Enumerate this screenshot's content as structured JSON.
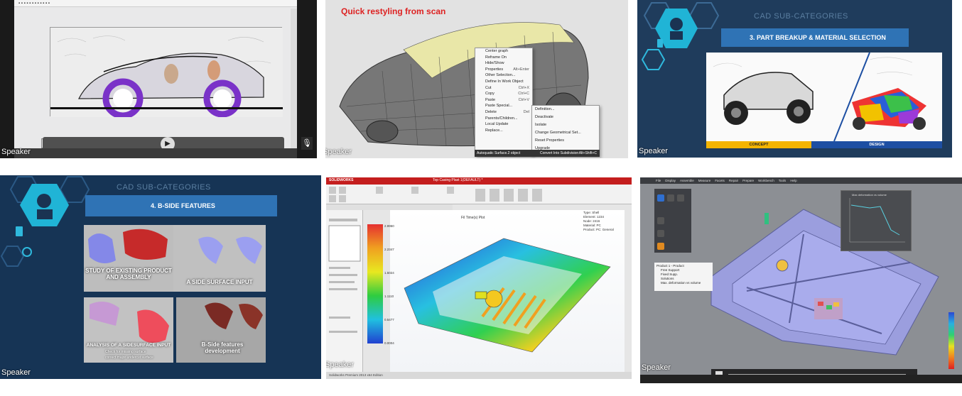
{
  "tiles": [
    {
      "speaker": "Speaker"
    },
    {
      "speaker": "Speaker",
      "heading": "Quick restyling from scan"
    },
    {
      "speaker": "Speaker",
      "category_title": "CAD SUB-CATEGORIES",
      "banner": "3. PART BREAKUP & MATERIAL SELECTION",
      "bar_left": "CONCEPT",
      "bar_right": "DESIGN"
    },
    {
      "speaker": "Speaker",
      "category_title": "CAD SUB-CATEGORIES",
      "banner": "4. B-SIDE FEATURES",
      "cards": {
        "study": "STUDY OF EXISTING PRODUCT AND ASSEMBLY",
        "aside": "A SIDE SURFACE INPUT",
        "analysis": "ANALYSIS OF A SIDESURFACE INPUT",
        "analysis_b1": "Check for missing surface",
        "analysis_b2": "correct major undercut surface",
        "bside": "B-Side features development"
      }
    },
    {
      "speaker": "Speaker",
      "app_logo": "SOLIDWORKS",
      "window_title": "Top Casing Plast 1(DEFAULT) *",
      "viewport_title": "Fil Time(s) Plot",
      "legend": [
        "2.9950",
        "2.2347",
        "1.5024",
        "1.1110",
        "0.5477",
        "0.0004"
      ],
      "info": [
        "Type: Shell",
        "Element: 1234",
        "Node: 2416",
        "Material: PC",
        "Product: PC: General"
      ],
      "status": "Solidworks Premium 2013 x64 Edition"
    },
    {
      "speaker": "Speaker",
      "menu": [
        "File",
        "Display",
        "Assemble",
        "Measure",
        "Facets",
        "Repair",
        "Prepare",
        "Workbench",
        "Tools",
        "Help"
      ],
      "graph_title": "Max deformation vs volume",
      "tree": [
        "Product 1 - Product",
        "Free Support",
        "Fixed Supp.",
        "Solutions",
        "Max. deformation vs volume"
      ]
    }
  ],
  "context_menu": [
    {
      "label": "Center graph",
      "shortcut": ""
    },
    {
      "label": "Reframe On",
      "shortcut": ""
    },
    {
      "label": "Hide/Show",
      "shortcut": ""
    },
    {
      "label": "Properties",
      "shortcut": "Alt+Enter"
    },
    {
      "label": "Other Selection...",
      "shortcut": ""
    },
    {
      "label": "Define In Work Object",
      "shortcut": ""
    },
    {
      "label": "Cut",
      "shortcut": "Ctrl+X"
    },
    {
      "label": "Copy",
      "shortcut": "Ctrl+C"
    },
    {
      "label": "Paste",
      "shortcut": "Ctrl+V"
    },
    {
      "label": "Paste Special...",
      "shortcut": ""
    },
    {
      "label": "Delete",
      "shortcut": "Del"
    },
    {
      "label": "Parents/Children...",
      "shortcut": ""
    },
    {
      "label": "Local Update",
      "shortcut": ""
    },
    {
      "label": "Replace...",
      "shortcut": ""
    }
  ],
  "sub_menu": [
    {
      "label": "Definition...",
      "shortcut": ""
    },
    {
      "label": "Deactivate",
      "shortcut": ""
    },
    {
      "label": "Isolate",
      "shortcut": ""
    },
    {
      "label": "Change Geometrical Set...",
      "shortcut": ""
    },
    {
      "label": "Reset Properties",
      "shortcut": ""
    },
    {
      "label": "Upgrade",
      "shortcut": ""
    }
  ],
  "bottom_menu_item": "Autoquatic Surface.2 object",
  "convert_item": "Convert Into Subdivision",
  "convert_shortcut": "Alt+Shift+C",
  "colors": {
    "accent_blue": "#2f73b5",
    "tile_bg_dark_blue": "#1f3c5c",
    "concept_bar": "#f3b400",
    "design_bar": "#1d4fa3",
    "restyle_heading": "#dd2222",
    "solidworks_red": "#c41e1e"
  }
}
